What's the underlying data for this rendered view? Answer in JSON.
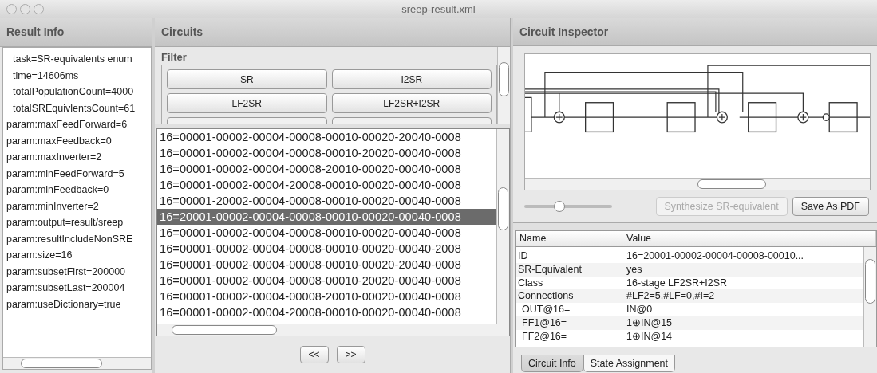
{
  "window": {
    "title": "sreep-result.xml"
  },
  "result_info": {
    "title": "Result Info",
    "items": [
      {
        "text": "task=SR-equivalents enum",
        "kind": "summary"
      },
      {
        "text": "time=14606ms",
        "kind": "summary"
      },
      {
        "text": "totalPopulationCount=4000",
        "kind": "summary"
      },
      {
        "text": "totalSREquivlentsCount=61",
        "kind": "summary"
      },
      {
        "text": "param:maxFeedForward=6",
        "kind": "param"
      },
      {
        "text": "param:maxFeedback=0",
        "kind": "param"
      },
      {
        "text": "param:maxInverter=2",
        "kind": "param"
      },
      {
        "text": "param:minFeedForward=5",
        "kind": "param"
      },
      {
        "text": "param:minFeedback=0",
        "kind": "param"
      },
      {
        "text": "param:minInverter=2",
        "kind": "param"
      },
      {
        "text": "param:output=result/sreep",
        "kind": "param"
      },
      {
        "text": "param:resultIncludeNonSRE",
        "kind": "param"
      },
      {
        "text": "param:size=16",
        "kind": "param"
      },
      {
        "text": "param:subsetFirst=200000",
        "kind": "param"
      },
      {
        "text": "param:subsetLast=200004",
        "kind": "param"
      },
      {
        "text": "param:useDictionary=true",
        "kind": "param"
      }
    ]
  },
  "circuits": {
    "title": "Circuits",
    "filter_label": "Filter",
    "filter_buttons": [
      "SR",
      "I2SR",
      "LF2SR",
      "LF2SR+I2SR"
    ],
    "rows": [
      {
        "text": "16=00001-00002-00004-00008-00010-00020-20040-0008",
        "selected": false
      },
      {
        "text": "16=00001-00002-00004-00008-00010-20020-00040-0008",
        "selected": false
      },
      {
        "text": "16=00001-00002-00004-00008-20010-00020-00040-0008",
        "selected": false
      },
      {
        "text": "16=00001-00002-00004-20008-00010-00020-00040-0008",
        "selected": false
      },
      {
        "text": "16=00001-20002-00004-00008-00010-00020-00040-0008",
        "selected": false
      },
      {
        "text": "16=20001-00002-00004-00008-00010-00020-00040-0008",
        "selected": true
      },
      {
        "text": "16=00001-00002-00004-00008-00010-00020-00040-0008",
        "selected": false
      },
      {
        "text": "16=00001-00002-00004-00008-00010-00020-00040-2008",
        "selected": false
      },
      {
        "text": "16=00001-00002-00004-00008-00010-00020-20040-0008",
        "selected": false
      },
      {
        "text": "16=00001-00002-00004-00008-00010-20020-00040-0008",
        "selected": false
      },
      {
        "text": "16=00001-00002-00004-00008-20010-00020-00040-0008",
        "selected": false
      },
      {
        "text": "16=00001-00002-00004-20008-00010-00020-00040-0008",
        "selected": false
      }
    ],
    "prev_button": "<<",
    "next_button": ">>"
  },
  "inspector": {
    "title": "Circuit Inspector",
    "zoom_slider": {
      "level": 0.4
    },
    "buttons": [
      {
        "label": "Synthesize SR-equivalent",
        "disabled": true
      },
      {
        "label": "Save As PDF",
        "disabled": false
      }
    ],
    "table": {
      "columns": [
        "Name",
        "Value"
      ],
      "rows": [
        {
          "name": "ID",
          "value": "16=20001-00002-00004-00008-00010...",
          "kind": "top"
        },
        {
          "name": "SR-Equivalent",
          "value": "yes",
          "kind": "top"
        },
        {
          "name": "Class",
          "value": "16-stage LF2SR+I2SR",
          "kind": "top"
        },
        {
          "name": "Connections",
          "value": "#LF2=5,#LF=0,#I=2",
          "kind": "top"
        },
        {
          "name": "OUT@16=",
          "value": "IN@0",
          "kind": "sub"
        },
        {
          "name": "FF1@16=",
          "value": "1⊕IN@15",
          "kind": "sub"
        },
        {
          "name": "FF2@16=",
          "value": "1⊕IN@14",
          "kind": "sub"
        }
      ]
    },
    "tabs": [
      {
        "label": "Circuit Info",
        "selected": true
      },
      {
        "label": "State Assignment",
        "selected": false
      }
    ]
  }
}
